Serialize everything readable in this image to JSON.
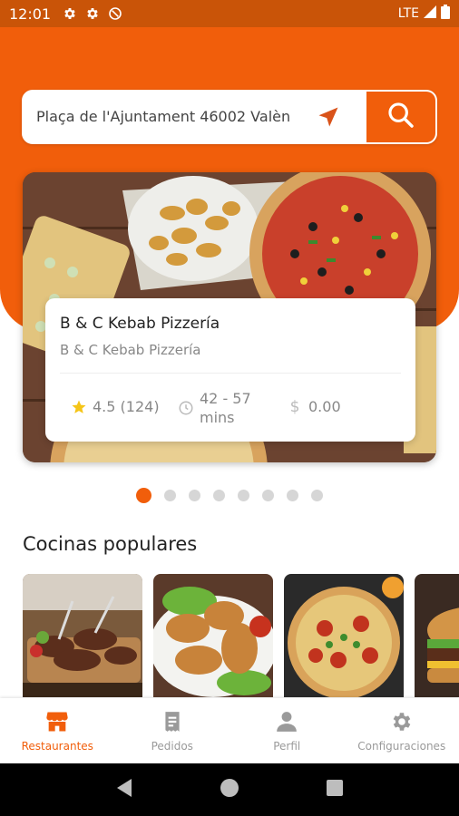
{
  "status_bar": {
    "time": "12:01",
    "network": "LTE"
  },
  "search": {
    "address": "Plaça de l'Ajuntament 46002 Valèn"
  },
  "featured": {
    "title": "B & C Kebab Pizzería",
    "subtitle": "B & C Kebab Pizzería",
    "rating": "4.5 (124)",
    "delivery_time": "42 - 57 mins",
    "delivery_fee": "0.00"
  },
  "carousel": {
    "total_slides": 8,
    "active_index": 0
  },
  "popular": {
    "title": "Cocinas populares",
    "items": [
      {
        "icon": "grilled-meat-photo"
      },
      {
        "icon": "fried-chicken-photo"
      },
      {
        "icon": "pizza-photo"
      },
      {
        "icon": "burger-photo"
      }
    ]
  },
  "nav": {
    "items": [
      {
        "label": "Restaurantes",
        "icon": "store-icon",
        "active": true
      },
      {
        "label": "Pedidos",
        "icon": "receipt-icon",
        "active": false
      },
      {
        "label": "Perfil",
        "icon": "person-icon",
        "active": false
      },
      {
        "label": "Configuraciones",
        "icon": "gear-icon",
        "active": false
      }
    ]
  },
  "colors": {
    "accent": "#f15e0b",
    "status_bar": "#c95408",
    "star": "#f5c518"
  }
}
